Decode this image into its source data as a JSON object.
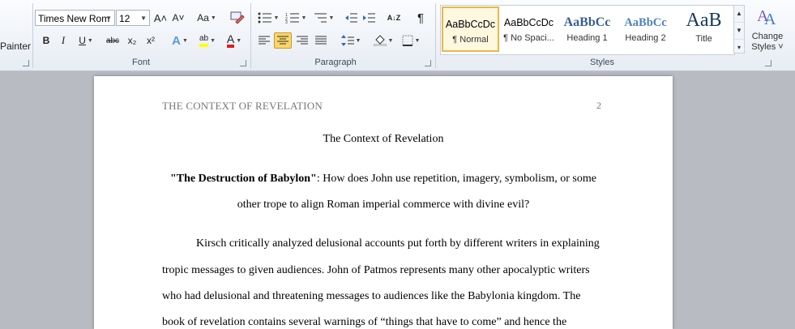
{
  "clipboard": {
    "painter_label": "Painter"
  },
  "font_group": {
    "label": "Font",
    "font_name": "Times New Rom",
    "font_size": "12",
    "grow_glyph": "A˄",
    "shrink_glyph": "A˅",
    "change_case": "Aa",
    "bold": "B",
    "italic": "I",
    "underline": "U",
    "strike": "abc",
    "subscript": "x₂",
    "superscript": "x²",
    "text_effects": "A",
    "highlight": "ab",
    "font_color": "A"
  },
  "paragraph_group": {
    "label": "Paragraph",
    "sort_glyph": "A↓Z",
    "pilcrow": "¶"
  },
  "styles_group": {
    "label": "Styles",
    "items": [
      {
        "preview": "AaBbCcDc",
        "name": "¶ Normal"
      },
      {
        "preview": "AaBbCcDc",
        "name": "¶ No Spaci..."
      },
      {
        "preview": "AaBbCс",
        "name": "Heading 1"
      },
      {
        "preview": "AaBbCc",
        "name": "Heading 2"
      },
      {
        "preview": "AaB",
        "name": "Title"
      }
    ],
    "change_styles_line1": "Change",
    "change_styles_line2": "Styles ˅"
  },
  "colors": {
    "accent_highlight": "#fbd567",
    "heading_blue": "#365f91",
    "font_color_red": "#e11d1d",
    "highlight_yellow": "#ffff00"
  },
  "document": {
    "running_head": "THE CONTEXT OF REVELATION",
    "page_number": "2",
    "title": "The Context of Revelation",
    "question_bold": "\"The Destruction of Babylon\"",
    "question_rest": ": How does John use repetition, imagery, symbolism, or some",
    "question_line2": "other trope to align Roman imperial commerce with divine evil?",
    "para_lines": [
      "Kirsch critically analyzed delusional accounts put forth by different writers in explaining",
      "tropic messages to given audiences.  John of Patmos represents many other apocalyptic writers",
      "who had delusional and threatening messages  to audiences like the Babylonia kingdom. The",
      "book of revelation contains several warnings of “things that have to come” and hence the"
    ]
  }
}
